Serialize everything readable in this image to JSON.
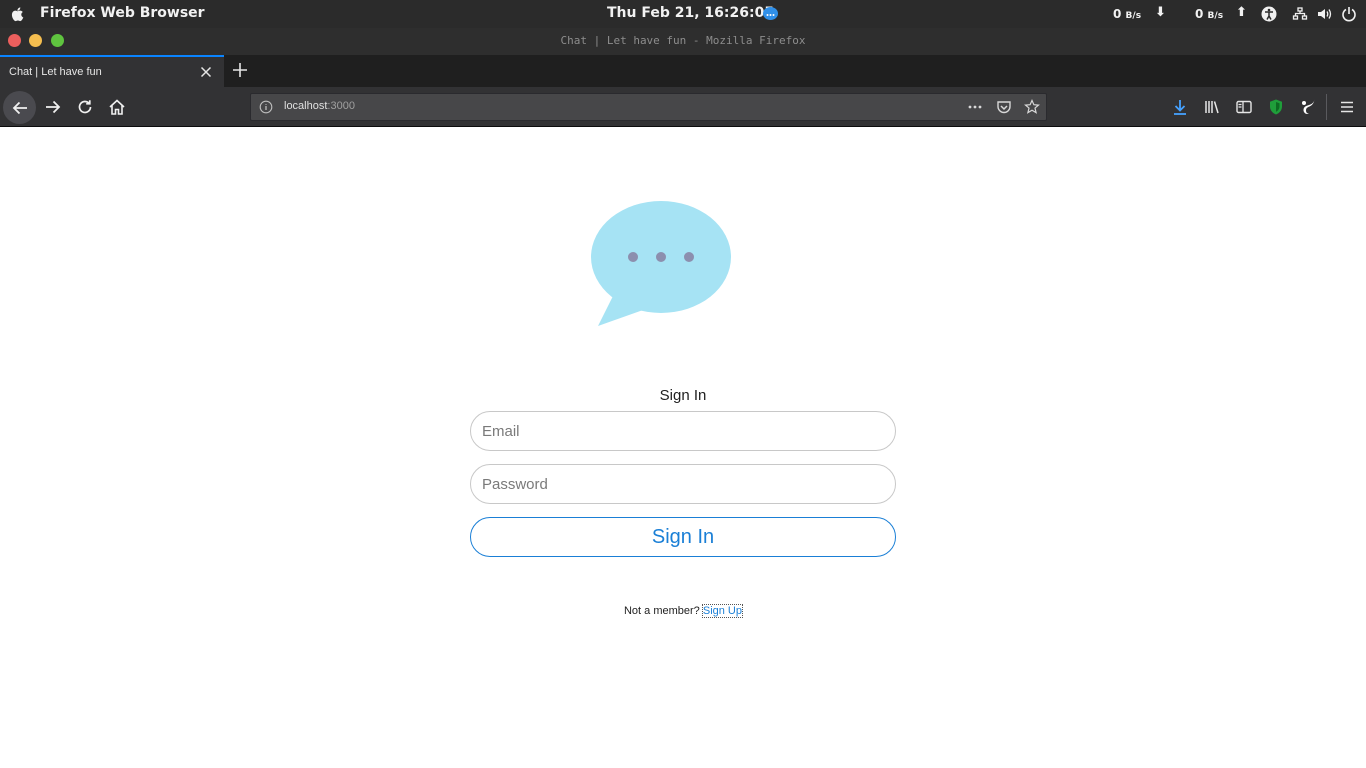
{
  "system_bar": {
    "app_name": "Firefox Web Browser",
    "clock": "Thu Feb 21, 16:26:05",
    "net_down_value": "0",
    "net_down_unit": "B/s",
    "net_up_value": "0",
    "net_up_unit": "B/s",
    "icons": [
      "apple-icon",
      "chat-indicator-icon",
      "download-arrow-icon",
      "upload-arrow-icon",
      "accessibility-icon",
      "network-icon",
      "volume-icon",
      "power-icon"
    ]
  },
  "window": {
    "title": "Chat | Let have fun - Mozilla Firefox",
    "traffic_lights": [
      "#ec5f5d",
      "#f5be4f",
      "#5fc43f"
    ]
  },
  "tabs": [
    {
      "label": "Chat | Let have fun",
      "active": true
    }
  ],
  "navbar": {
    "url_host": "localhost",
    "url_port": ":3000",
    "icons": [
      "back-icon",
      "forward-icon",
      "reload-icon",
      "home-icon",
      "site-info-icon",
      "page-actions-icon",
      "pocket-icon",
      "bookmark-star-icon",
      "downloads-icon",
      "library-icon",
      "sidebar-icon",
      "shield-extension-icon",
      "gnome-extension-icon",
      "hamburger-menu-icon"
    ]
  },
  "page": {
    "logo": "chat-bubble-logo",
    "colors": {
      "bubble": "#a6e3f4",
      "dots": "#8c8fae",
      "accent": "#1a7fd6"
    },
    "form": {
      "title": "Sign In",
      "email_placeholder": "Email",
      "password_placeholder": "Password",
      "submit_label": "Sign In"
    },
    "footer": {
      "prompt": "Not a member?",
      "link_label": "Sign Up"
    }
  }
}
